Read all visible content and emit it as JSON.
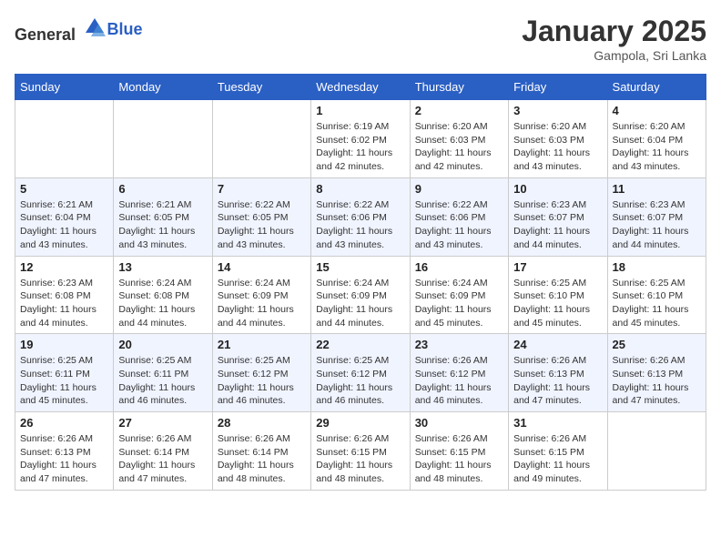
{
  "header": {
    "logo_general": "General",
    "logo_blue": "Blue",
    "month_year": "January 2025",
    "location": "Gampola, Sri Lanka"
  },
  "days_of_week": [
    "Sunday",
    "Monday",
    "Tuesday",
    "Wednesday",
    "Thursday",
    "Friday",
    "Saturday"
  ],
  "weeks": [
    {
      "days": [
        {
          "num": "",
          "sunrise": "",
          "sunset": "",
          "daylight": ""
        },
        {
          "num": "",
          "sunrise": "",
          "sunset": "",
          "daylight": ""
        },
        {
          "num": "",
          "sunrise": "",
          "sunset": "",
          "daylight": ""
        },
        {
          "num": "1",
          "sunrise": "Sunrise: 6:19 AM",
          "sunset": "Sunset: 6:02 PM",
          "daylight": "Daylight: 11 hours and 42 minutes."
        },
        {
          "num": "2",
          "sunrise": "Sunrise: 6:20 AM",
          "sunset": "Sunset: 6:03 PM",
          "daylight": "Daylight: 11 hours and 42 minutes."
        },
        {
          "num": "3",
          "sunrise": "Sunrise: 6:20 AM",
          "sunset": "Sunset: 6:03 PM",
          "daylight": "Daylight: 11 hours and 43 minutes."
        },
        {
          "num": "4",
          "sunrise": "Sunrise: 6:20 AM",
          "sunset": "Sunset: 6:04 PM",
          "daylight": "Daylight: 11 hours and 43 minutes."
        }
      ]
    },
    {
      "days": [
        {
          "num": "5",
          "sunrise": "Sunrise: 6:21 AM",
          "sunset": "Sunset: 6:04 PM",
          "daylight": "Daylight: 11 hours and 43 minutes."
        },
        {
          "num": "6",
          "sunrise": "Sunrise: 6:21 AM",
          "sunset": "Sunset: 6:05 PM",
          "daylight": "Daylight: 11 hours and 43 minutes."
        },
        {
          "num": "7",
          "sunrise": "Sunrise: 6:22 AM",
          "sunset": "Sunset: 6:05 PM",
          "daylight": "Daylight: 11 hours and 43 minutes."
        },
        {
          "num": "8",
          "sunrise": "Sunrise: 6:22 AM",
          "sunset": "Sunset: 6:06 PM",
          "daylight": "Daylight: 11 hours and 43 minutes."
        },
        {
          "num": "9",
          "sunrise": "Sunrise: 6:22 AM",
          "sunset": "Sunset: 6:06 PM",
          "daylight": "Daylight: 11 hours and 43 minutes."
        },
        {
          "num": "10",
          "sunrise": "Sunrise: 6:23 AM",
          "sunset": "Sunset: 6:07 PM",
          "daylight": "Daylight: 11 hours and 44 minutes."
        },
        {
          "num": "11",
          "sunrise": "Sunrise: 6:23 AM",
          "sunset": "Sunset: 6:07 PM",
          "daylight": "Daylight: 11 hours and 44 minutes."
        }
      ]
    },
    {
      "days": [
        {
          "num": "12",
          "sunrise": "Sunrise: 6:23 AM",
          "sunset": "Sunset: 6:08 PM",
          "daylight": "Daylight: 11 hours and 44 minutes."
        },
        {
          "num": "13",
          "sunrise": "Sunrise: 6:24 AM",
          "sunset": "Sunset: 6:08 PM",
          "daylight": "Daylight: 11 hours and 44 minutes."
        },
        {
          "num": "14",
          "sunrise": "Sunrise: 6:24 AM",
          "sunset": "Sunset: 6:09 PM",
          "daylight": "Daylight: 11 hours and 44 minutes."
        },
        {
          "num": "15",
          "sunrise": "Sunrise: 6:24 AM",
          "sunset": "Sunset: 6:09 PM",
          "daylight": "Daylight: 11 hours and 44 minutes."
        },
        {
          "num": "16",
          "sunrise": "Sunrise: 6:24 AM",
          "sunset": "Sunset: 6:09 PM",
          "daylight": "Daylight: 11 hours and 45 minutes."
        },
        {
          "num": "17",
          "sunrise": "Sunrise: 6:25 AM",
          "sunset": "Sunset: 6:10 PM",
          "daylight": "Daylight: 11 hours and 45 minutes."
        },
        {
          "num": "18",
          "sunrise": "Sunrise: 6:25 AM",
          "sunset": "Sunset: 6:10 PM",
          "daylight": "Daylight: 11 hours and 45 minutes."
        }
      ]
    },
    {
      "days": [
        {
          "num": "19",
          "sunrise": "Sunrise: 6:25 AM",
          "sunset": "Sunset: 6:11 PM",
          "daylight": "Daylight: 11 hours and 45 minutes."
        },
        {
          "num": "20",
          "sunrise": "Sunrise: 6:25 AM",
          "sunset": "Sunset: 6:11 PM",
          "daylight": "Daylight: 11 hours and 46 minutes."
        },
        {
          "num": "21",
          "sunrise": "Sunrise: 6:25 AM",
          "sunset": "Sunset: 6:12 PM",
          "daylight": "Daylight: 11 hours and 46 minutes."
        },
        {
          "num": "22",
          "sunrise": "Sunrise: 6:25 AM",
          "sunset": "Sunset: 6:12 PM",
          "daylight": "Daylight: 11 hours and 46 minutes."
        },
        {
          "num": "23",
          "sunrise": "Sunrise: 6:26 AM",
          "sunset": "Sunset: 6:12 PM",
          "daylight": "Daylight: 11 hours and 46 minutes."
        },
        {
          "num": "24",
          "sunrise": "Sunrise: 6:26 AM",
          "sunset": "Sunset: 6:13 PM",
          "daylight": "Daylight: 11 hours and 47 minutes."
        },
        {
          "num": "25",
          "sunrise": "Sunrise: 6:26 AM",
          "sunset": "Sunset: 6:13 PM",
          "daylight": "Daylight: 11 hours and 47 minutes."
        }
      ]
    },
    {
      "days": [
        {
          "num": "26",
          "sunrise": "Sunrise: 6:26 AM",
          "sunset": "Sunset: 6:13 PM",
          "daylight": "Daylight: 11 hours and 47 minutes."
        },
        {
          "num": "27",
          "sunrise": "Sunrise: 6:26 AM",
          "sunset": "Sunset: 6:14 PM",
          "daylight": "Daylight: 11 hours and 47 minutes."
        },
        {
          "num": "28",
          "sunrise": "Sunrise: 6:26 AM",
          "sunset": "Sunset: 6:14 PM",
          "daylight": "Daylight: 11 hours and 48 minutes."
        },
        {
          "num": "29",
          "sunrise": "Sunrise: 6:26 AM",
          "sunset": "Sunset: 6:15 PM",
          "daylight": "Daylight: 11 hours and 48 minutes."
        },
        {
          "num": "30",
          "sunrise": "Sunrise: 6:26 AM",
          "sunset": "Sunset: 6:15 PM",
          "daylight": "Daylight: 11 hours and 48 minutes."
        },
        {
          "num": "31",
          "sunrise": "Sunrise: 6:26 AM",
          "sunset": "Sunset: 6:15 PM",
          "daylight": "Daylight: 11 hours and 49 minutes."
        },
        {
          "num": "",
          "sunrise": "",
          "sunset": "",
          "daylight": ""
        }
      ]
    }
  ]
}
